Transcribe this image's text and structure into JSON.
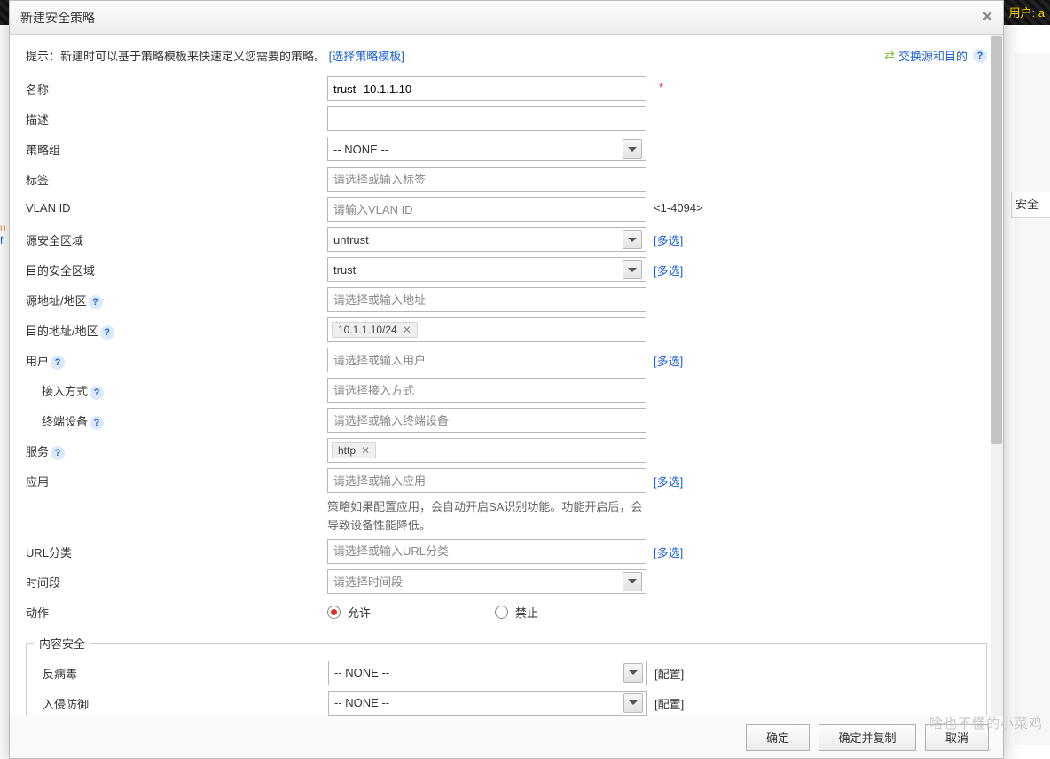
{
  "background": {
    "user_label": "用户: a",
    "side_tab": "安全"
  },
  "dialog": {
    "title": "新建安全策略",
    "close": "×",
    "hint_prefix": "提示：新建时可以基于策略模板来快速定义您需要的策略。",
    "hint_link": "[选择策略模板]",
    "swap_text": "交换源和目的"
  },
  "labels": {
    "name": "名称",
    "desc": "描述",
    "policy_group": "策略组",
    "tags": "标签",
    "vlan": "VLAN ID",
    "src_zone": "源安全区域",
    "dst_zone": "目的安全区域",
    "src_addr": "源地址/地区",
    "dst_addr": "目的地址/地区",
    "user": "用户",
    "access_mode": "接入方式",
    "terminal": "终端设备",
    "service": "服务",
    "app": "应用",
    "url_cat": "URL分类",
    "time": "时间段",
    "action": "动作",
    "content_sec": "内容安全",
    "antivirus": "反病毒",
    "ips": "入侵防御"
  },
  "values": {
    "name": "trust--10.1.1.10",
    "policy_group": "-- NONE --",
    "src_zone": "untrust",
    "dst_zone": "trust",
    "dst_addr_chip": "10.1.1.10/24",
    "service_chip": "http",
    "antivirus": "-- NONE --",
    "ips": "-- NONE --"
  },
  "placeholders": {
    "tags": "请选择或输入标签",
    "vlan": "请输入VLAN ID",
    "src_addr": "请选择或输入地址",
    "user": "请选择或输入用户",
    "access_mode": "请选择接入方式",
    "terminal": "请选择或输入终端设备",
    "app": "请选择或输入应用",
    "url_cat": "请选择或输入URL分类",
    "time": "请选择时间段"
  },
  "extras": {
    "vlan_range": "<1-4094>",
    "multi": "[多选]",
    "config": "[配置]",
    "app_note": "策略如果配置应用，会自动开启SA识别功能。功能开启后，会导致设备性能降低。"
  },
  "action_opts": {
    "allow": "允许",
    "deny": "禁止"
  },
  "footer": {
    "ok": "确定",
    "ok_copy": "确定并复制",
    "cancel": "取消"
  },
  "watermark": "啥也不懂的小菜鸡"
}
